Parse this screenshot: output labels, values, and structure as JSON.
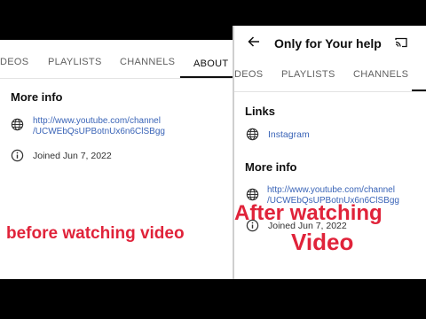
{
  "left": {
    "tabs": [
      {
        "label": "DEOS"
      },
      {
        "label": "PLAYLISTS"
      },
      {
        "label": "CHANNELS"
      },
      {
        "label": "ABOUT"
      }
    ],
    "more_info_heading": "More info",
    "channel_url_line1": "http://www.youtube.com/channel",
    "channel_url_line2": "/UCWEbQsUPBotnUx6n6ClSBgg",
    "joined": "Joined Jun 7, 2022",
    "overlay_caption": "before watching video"
  },
  "right": {
    "title": "Only for Your help",
    "tabs": [
      {
        "label": "DEOS"
      },
      {
        "label": "PLAYLISTS"
      },
      {
        "label": "CHANNELS"
      }
    ],
    "links_heading": "Links",
    "instagram_label": "Instagram",
    "more_info_heading": "More info",
    "channel_url_line1": "http://www.youtube.com/channel",
    "channel_url_line2": "/UCWEbQsUPBotnUx6n6ClSBgg",
    "joined": "Joined Jun 7, 2022",
    "overlay_line1": "After  watching",
    "overlay_line2": "Video"
  },
  "colors": {
    "link": "#3a64b7",
    "overlay_red": "#e0233a",
    "background": "#000000"
  },
  "icons": [
    "globe-icon",
    "info-icon",
    "back-arrow-icon",
    "cast-icon"
  ]
}
